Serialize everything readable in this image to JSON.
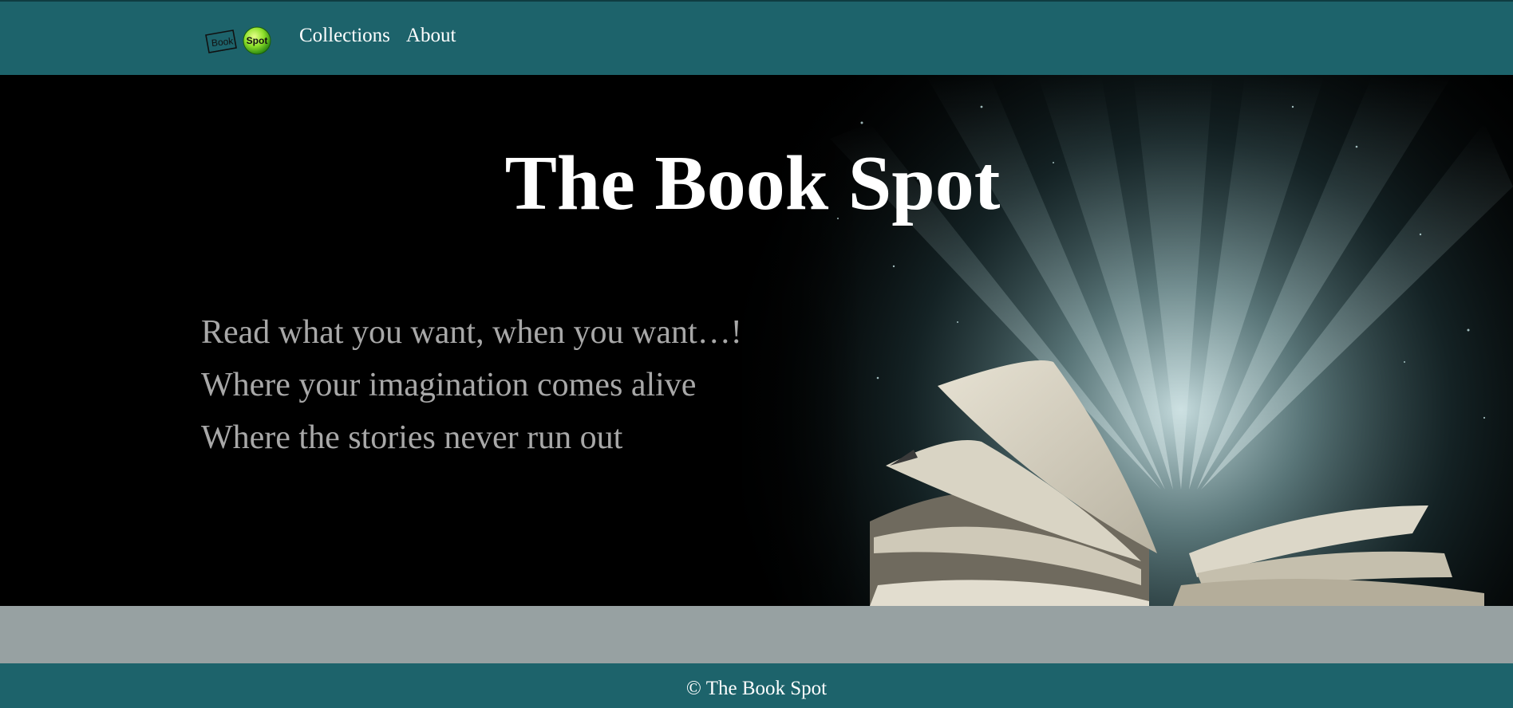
{
  "brand": {
    "logo_word_1": "Book",
    "logo_word_2": "Spot"
  },
  "nav": {
    "links": [
      {
        "label": "Collections"
      },
      {
        "label": "About"
      }
    ]
  },
  "hero": {
    "title": "The Book Spot",
    "taglines": [
      "Read what you want, when you want…!",
      "Where your imagination comes alive",
      "Where the stories never run out"
    ]
  },
  "footer": {
    "text": "© The Book Spot"
  },
  "colors": {
    "nav_bg": "#1d636b",
    "band_bg": "#97a1a2",
    "hero_bg": "#000000",
    "tagline": "#a8a8a8",
    "logo_green": "#7ed321"
  },
  "icons": {
    "logo": "book-spot-logo"
  }
}
